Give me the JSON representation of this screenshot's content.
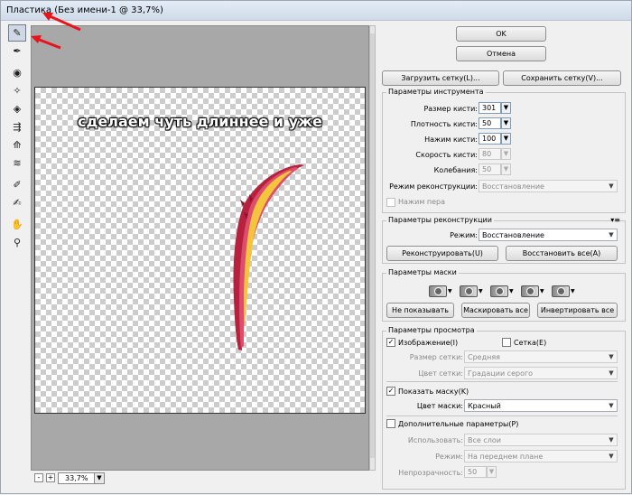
{
  "window": {
    "title": "Пластика (Без имени-1 @ 33,7%)"
  },
  "tools": [
    {
      "name": "forward-warp-tool-icon",
      "glyph": "✎",
      "active": true
    },
    {
      "name": "reconstruct-tool-icon",
      "glyph": "✒",
      "active": false
    },
    {
      "name": "twirl-clockwise-tool-icon",
      "glyph": "◉",
      "active": false
    },
    {
      "name": "pucker-tool-icon",
      "glyph": "✧",
      "active": false
    },
    {
      "name": "bloat-tool-icon",
      "glyph": "◈",
      "active": false
    },
    {
      "name": "push-left-tool-icon",
      "glyph": "⇶",
      "active": false
    },
    {
      "name": "mirror-tool-icon",
      "glyph": "⟰",
      "active": false
    },
    {
      "name": "turbulence-tool-icon",
      "glyph": "≋",
      "active": false
    },
    {
      "name": "freeze-mask-tool-icon",
      "glyph": "✐",
      "active": false
    },
    {
      "name": "thaw-mask-tool-icon",
      "glyph": "✍",
      "active": false
    },
    {
      "name": "hand-tool-icon",
      "glyph": "✋",
      "active": false
    },
    {
      "name": "zoom-tool-icon",
      "glyph": "⚲",
      "active": false
    }
  ],
  "canvas": {
    "caption": "сделаем чуть длиннее и уже"
  },
  "status": {
    "zoom_out": "-",
    "zoom_in": "+",
    "zoom": "33,7%"
  },
  "buttons": {
    "ok": "OK",
    "cancel": "Отмена",
    "load_mesh": "Загрузить сетку(L)...",
    "save_mesh": "Сохранить сетку(V)..."
  },
  "tool_options": {
    "title": "Параметры инструмента",
    "brush_size_label": "Размер кисти:",
    "brush_size": "301",
    "brush_density_label": "Плотность кисти:",
    "brush_density": "50",
    "brush_pressure_label": "Нажим кисти:",
    "brush_pressure": "100",
    "brush_rate_label": "Скорость кисти:",
    "brush_rate": "80",
    "turbulent_jitter_label": "Колебания:",
    "turbulent_jitter": "50",
    "reconstruct_mode_label": "Режим реконструкции:",
    "reconstruct_mode": "Восстановление",
    "stylus_pressure_label": "Нажим пера",
    "stylus_pressure": false
  },
  "reconstruct_options": {
    "title": "Параметры реконструкции",
    "mode_label": "Режим:",
    "mode": "Восстановление",
    "reconstruct_button": "Реконструировать(U)",
    "restore_all_button": "Восстановить все(A)"
  },
  "mask_options": {
    "title": "Параметры маски",
    "icons": [
      "replace-selection-icon",
      "add-to-selection-icon",
      "subtract-from-selection-icon",
      "intersect-with-selection-icon",
      "invert-selection-icon"
    ],
    "none_button": "Не показывать",
    "mask_all_button": "Маскировать все",
    "invert_all_button": "Инвертировать все"
  },
  "view_options": {
    "title": "Параметры просмотра",
    "show_image_label": "Изображение(I)",
    "show_image": true,
    "show_mesh_label": "Сетка(E)",
    "show_mesh": false,
    "mesh_size_label": "Размер сетки:",
    "mesh_size": "Средняя",
    "mesh_color_label": "Цвет сетки:",
    "mesh_color": "Градации серого",
    "show_mask_label": "Показать маску(K)",
    "show_mask": true,
    "mask_color_label": "Цвет маски:",
    "mask_color": "Красный",
    "show_backdrop_label": "Дополнительные параметры(P)",
    "show_backdrop": false,
    "use_label": "Использовать:",
    "use": "Все слои",
    "mode_label": "Режим:",
    "mode": "На переднем плане",
    "opacity_label": "Непрозрачность:",
    "opacity": "50"
  },
  "colors": {
    "arrow": "#e8141c",
    "stroke_dark": "#b8213e",
    "stroke_mid": "#dc4f6c",
    "stroke_light": "#f5c43d"
  }
}
